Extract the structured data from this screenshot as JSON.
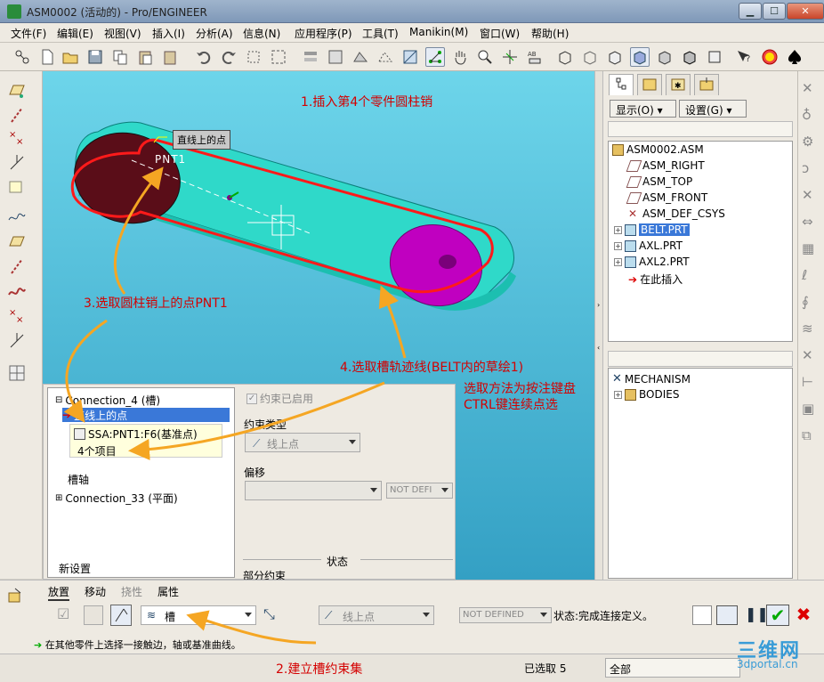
{
  "window": {
    "title": "ASM0002 (活动的) - Pro/ENGINEER",
    "min": "▁",
    "max": "☐",
    "close": "✕"
  },
  "menu": [
    "文件(F)",
    "编辑(E)",
    "视图(V)",
    "插入(I)",
    "分析(A)",
    "信息(N)",
    "应用程序(P)",
    "工具(T)",
    "Manikin(M)",
    "窗口(W)",
    "帮助(H)"
  ],
  "annotations": {
    "a1": "1.插入第4个零件圆柱销",
    "a2": "2.建立槽约束集",
    "a3": "3.选取圆柱销上的点PNT1",
    "a4": "4.选取槽轨迹线(BELT内的草绘1)",
    "a5_l1": "选取方法为按注键盘",
    "a5_l2": "CTRL键连续点选"
  },
  "viewport": {
    "tag_label": "直线上的点",
    "pnt_label": "PNT1"
  },
  "panel": {
    "show_btn": "显示(O) ▾",
    "settings_btn": "设置(G) ▾",
    "tree": [
      {
        "label": "ASM0002.ASM"
      },
      {
        "label": "ASM_RIGHT"
      },
      {
        "label": "ASM_TOP"
      },
      {
        "label": "ASM_FRONT"
      },
      {
        "label": "ASM_DEF_CSYS"
      },
      {
        "label": "BELT.PRT"
      },
      {
        "label": "AXL.PRT"
      },
      {
        "label": "AXL2.PRT"
      },
      {
        "label": "在此插入"
      }
    ],
    "tree2": [
      {
        "label": "MECHANISM"
      },
      {
        "label": "BODIES"
      }
    ]
  },
  "dialog": {
    "conn4": "Connection_4 (槽)",
    "point_on_line": "直线上的点",
    "ref1": "SSA:PNT1:F6(基准点)",
    "ref2": "4个项目",
    "slot_axis": "槽轴",
    "conn33": "Connection_33 (平面)",
    "new_set": "新设置",
    "enabled_label": "约束已启用",
    "ctype_label": "约束类型",
    "ctype_value": "线上点",
    "offset_label": "偏移",
    "notdef": "NOT DEFI",
    "status_label": "状态",
    "partial": "部分约束"
  },
  "dashboard": {
    "tabs": [
      "放置",
      "移动",
      "挠性",
      "属性"
    ],
    "joint_type": "槽",
    "constraint": "线上点",
    "notdef": "NOT DEFINED",
    "status": "状态:完成连接定义。"
  },
  "status": {
    "message": "在其他零件上选择一接触边，轴或基准曲线。",
    "selected": "已选取 5",
    "filter": "全部",
    "watermark1": "三维网",
    "watermark2": "3dportal.cn"
  },
  "colors": {
    "accent_red": "#d40000",
    "arrow_orange": "#f5a623",
    "belt_cyan": "#2fd9c9",
    "disc_magenta": "#c000c0"
  }
}
